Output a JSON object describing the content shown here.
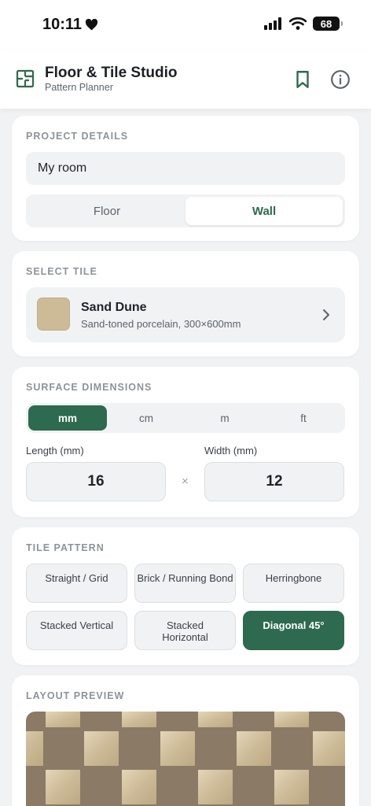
{
  "status": {
    "time": "10:11",
    "battery": "68"
  },
  "header": {
    "title": "Floor & Tile Studio",
    "subtitle": "Pattern Planner"
  },
  "project": {
    "label": "PROJECT DETAILS",
    "name_value": "My room",
    "surface_options": [
      "Floor",
      "Wall"
    ],
    "selected_surface": "Wall"
  },
  "tile": {
    "label": "SELECT TILE",
    "name": "Sand Dune",
    "description": "Sand-toned porcelain, 300×600mm",
    "swatch_color": "#cdbb98"
  },
  "dimensions": {
    "label": "SURFACE DIMENSIONS",
    "units": [
      "mm",
      "cm",
      "m",
      "ft"
    ],
    "selected_unit": "mm",
    "length_label": "Length (mm)",
    "length_value": "16",
    "width_label": "Width (mm)",
    "width_value": "12",
    "times_symbol": "×"
  },
  "pattern": {
    "label": "TILE PATTERN",
    "options": [
      "Straight / Grid",
      "Brick / Running Bond",
      "Herringbone",
      "Stacked Vertical",
      "Stacked Horizontal",
      "Diagonal 45°"
    ],
    "selected": "Diagonal 45°"
  },
  "preview": {
    "label": "LAYOUT PREVIEW",
    "grout_color": "#8a7a66",
    "tile_color": "#cdbb98"
  },
  "colors": {
    "accent": "#2d6a4f",
    "background": "#f1f2f4"
  }
}
